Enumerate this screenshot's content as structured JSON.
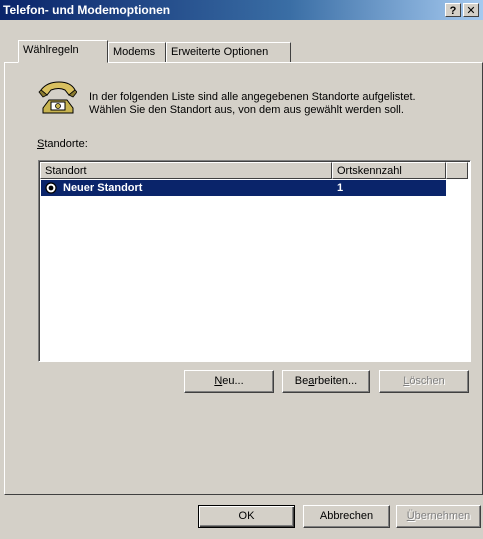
{
  "window": {
    "title": "Telefon- und Modemoptionen",
    "help_button": "?",
    "close_button": "✕"
  },
  "tabs": [
    {
      "label": "Wählregeln",
      "active": true
    },
    {
      "label": "Modems",
      "active": false
    },
    {
      "label": "Erweiterte Optionen",
      "active": false
    }
  ],
  "intro": {
    "icon": "telephone-icon",
    "line1": "In der folgenden Liste sind alle angegebenen Standorte aufgelistet.",
    "line2": "Wählen Sie den Standort aus, von dem aus gewählt werden soll."
  },
  "locations": {
    "label_prefix": "S",
    "label_rest": "tandorte:",
    "columns": [
      "Standort",
      "Ortskennzahl"
    ],
    "rows": [
      {
        "name": "Neuer Standort",
        "area_code": "1",
        "selected": true
      }
    ]
  },
  "list_buttons": {
    "new": {
      "mnemonic": "N",
      "rest": "eu..."
    },
    "edit": {
      "pre": "Be",
      "mnemonic": "a",
      "rest": "rbeiten..."
    },
    "delete": {
      "mnemonic": "L",
      "rest": "öschen",
      "disabled": true
    }
  },
  "dialog_buttons": {
    "ok": "OK",
    "cancel": "Abbrechen",
    "apply": {
      "mnemonic": "Ü",
      "rest": "bernehmen",
      "disabled": true
    }
  },
  "colors": {
    "selection": "#0a246a",
    "face": "#d4d0c8",
    "title_start": "#0a246a",
    "title_end": "#a6caf0"
  }
}
